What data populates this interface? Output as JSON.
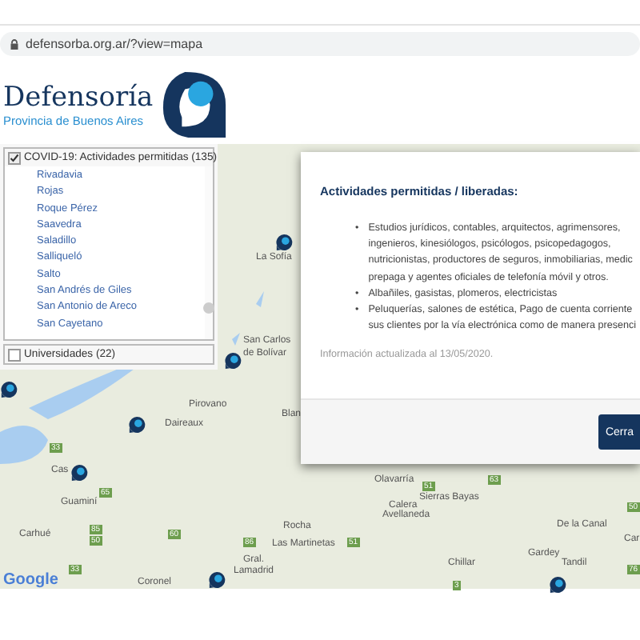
{
  "browser": {
    "url": "defensorba.org.ar/?view=mapa"
  },
  "logo": {
    "name": "Defensoría",
    "subtitle": "Provincia de Buenos Aires"
  },
  "layers": [
    {
      "label": "COVID-19: Actividades permitidas (135)",
      "checked": true,
      "items": [
        "Rivadavia",
        "Rojas",
        "Roque Pérez",
        "Saavedra",
        "Saladillo",
        "Salliqueló",
        "Salto",
        "San Andrés de Giles",
        "San Antonio de Areco",
        "San Cayetano"
      ]
    },
    {
      "label": "Universidades (22)",
      "checked": false
    }
  ],
  "map": {
    "places": [
      "La Sofía",
      "San Carlos",
      "de Bolívar",
      "Pirovano",
      "Daireaux",
      "Cas",
      "Guaminí",
      "Carhué",
      "Olavarría",
      "Sierras Bayas",
      "Calera",
      "Avellaneda",
      "Rocha",
      "Las Martinetas",
      "Gral.",
      "Lamadrid",
      "Coronel",
      "Chillar",
      "De la Canal",
      "Gardey",
      "Tandil",
      "Car",
      "Blan"
    ],
    "roads": [
      "33",
      "65",
      "85",
      "50",
      "60",
      "86",
      "51",
      "51",
      "63",
      "50",
      "76",
      "3",
      "33"
    ],
    "attribution": "Google"
  },
  "modal": {
    "title": "Actividades permitidas / liberadas:",
    "bullets": [
      {
        "marker": "•",
        "lines": [
          "Estudios jurídicos, contables, arquitectos, agrimensores,",
          "ingenieros, kinesiólogos, psicólogos, psicopedagogos,",
          "nutricionistas, productores de seguros, inmobiliarias, medic",
          "prepaga y agentes oficiales de telefonía móvil y otros."
        ]
      },
      {
        "marker": "•",
        "lines": [
          "Albañiles, gasistas, plomeros, electricistas"
        ]
      },
      {
        "marker": "•",
        "lines": [
          "Peluquerías, salones de estética, Pago de cuenta corriente",
          "sus clientes por la vía electrónica como de manera presenci"
        ]
      }
    ],
    "note": "Información actualizada al 13/05/2020.",
    "button": "Cerra"
  }
}
